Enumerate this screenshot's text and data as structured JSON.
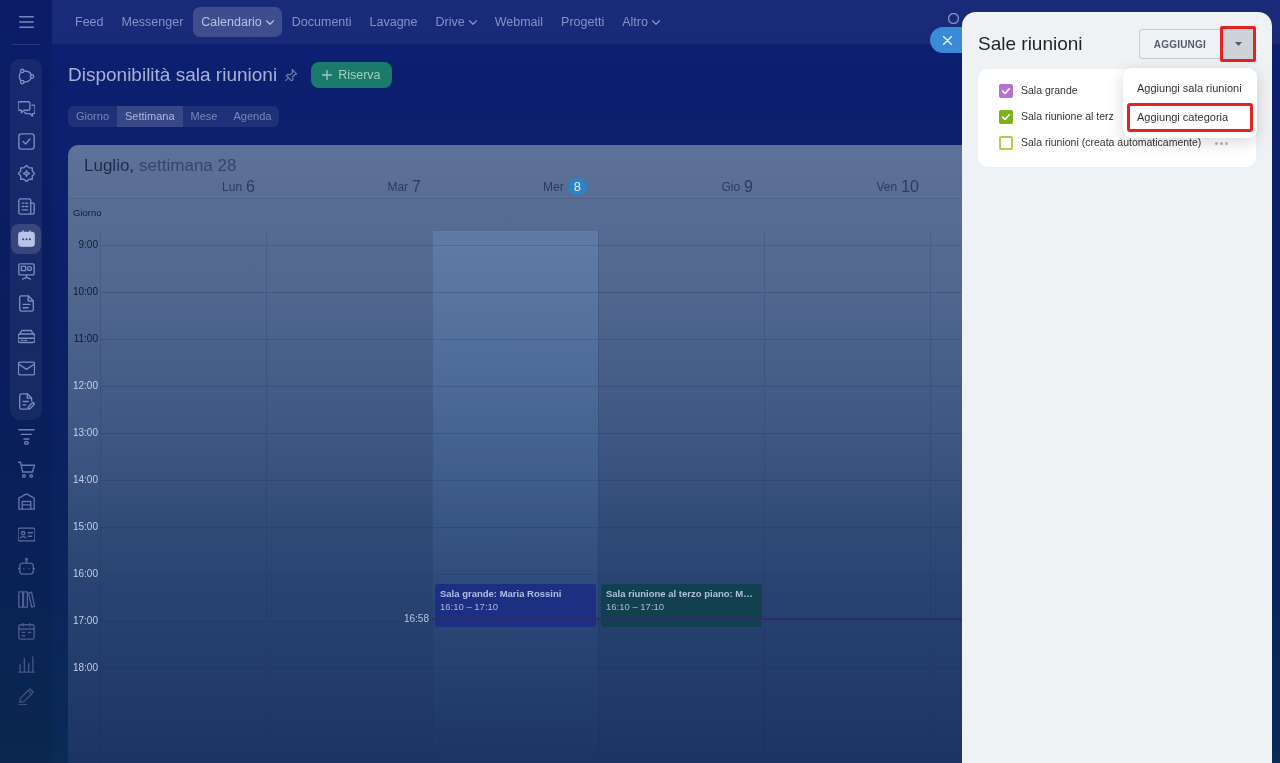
{
  "sidebar": {
    "group_items": [
      {
        "kind": "nodes",
        "selected": false
      },
      {
        "kind": "chats",
        "selected": false
      },
      {
        "kind": "tasks",
        "selected": false
      },
      {
        "kind": "badge",
        "selected": false
      },
      {
        "kind": "news",
        "selected": false
      },
      {
        "kind": "calendar",
        "selected": true
      },
      {
        "kind": "board",
        "selected": false
      },
      {
        "kind": "document",
        "selected": false
      },
      {
        "kind": "drive",
        "selected": false
      },
      {
        "kind": "mail",
        "selected": false
      },
      {
        "kind": "docedit",
        "selected": false
      }
    ],
    "items": [
      {
        "kind": "funnel",
        "selected": false
      },
      {
        "kind": "cart",
        "selected": false
      },
      {
        "kind": "garage",
        "selected": false
      },
      {
        "kind": "contact",
        "selected": false
      },
      {
        "kind": "robot",
        "selected": false
      },
      {
        "kind": "books",
        "selected": false
      },
      {
        "kind": "schedule",
        "selected": false
      },
      {
        "kind": "chart",
        "selected": false
      },
      {
        "kind": "pen",
        "selected": false
      }
    ]
  },
  "top_nav": [
    {
      "label": "Feed",
      "selected": false,
      "dropdown": false
    },
    {
      "label": "Messenger",
      "selected": false,
      "dropdown": false
    },
    {
      "label": "Calendario",
      "selected": true,
      "dropdown": true
    },
    {
      "label": "Documenti",
      "selected": false,
      "dropdown": false
    },
    {
      "label": "Lavagne",
      "selected": false,
      "dropdown": false
    },
    {
      "label": "Drive",
      "selected": false,
      "dropdown": true
    },
    {
      "label": "Webmail",
      "selected": false,
      "dropdown": false
    },
    {
      "label": "Progetti",
      "selected": false,
      "dropdown": false
    },
    {
      "label": "Altro",
      "selected": false,
      "dropdown": true
    }
  ],
  "page": {
    "title": "Disponibilità sala riunioni",
    "primary_button": "Riserva",
    "views": [
      {
        "label": "Giorno",
        "selected": false
      },
      {
        "label": "Settimana",
        "selected": true
      },
      {
        "label": "Mese",
        "selected": false
      },
      {
        "label": "Agenda",
        "selected": false
      }
    ]
  },
  "calendar": {
    "month": "Luglio,",
    "week": "settimana 28",
    "all_day_label": "Giorno",
    "days": [
      {
        "name": "Lun",
        "number": "6",
        "today": false
      },
      {
        "name": "Mar",
        "number": "7",
        "today": false
      },
      {
        "name": "Mer",
        "number": "8",
        "today": true,
        "events": [
          {
            "title": "Sala grande: Maria Rossini",
            "time": "16:10 – 17:10",
            "color": "#1d2f80"
          }
        ]
      },
      {
        "name": "Gio",
        "number": "9",
        "today": false,
        "events": [
          {
            "title": "Sala riunione al terzo piano: M…",
            "time": "16:10 – 17:10",
            "color": "#12404e"
          }
        ]
      },
      {
        "name": "Ven",
        "number": "10",
        "today": false
      }
    ],
    "hours": [
      "9:00",
      "10:00",
      "11:00",
      "12:00",
      "13:00",
      "14:00",
      "15:00",
      "16:00",
      "17:00",
      "18:00"
    ],
    "now": "16:58"
  },
  "panel": {
    "title": "Sale riunioni",
    "add_button": "AGGIUNGI",
    "toggle": {
      "highlighted": true
    },
    "menu": [
      {
        "label": "Aggiungi sala riunioni",
        "highlighted": false
      },
      {
        "label": "Aggiungi categoria",
        "highlighted": true
      }
    ],
    "rooms": [
      {
        "label": "Sala grande",
        "checked": true,
        "color": "#b870d0",
        "hovered": false
      },
      {
        "label": "Sala riunione al terz",
        "checked": true,
        "color": "#7eb21c",
        "hovered": false
      },
      {
        "label": "Sala riunioni (creata automaticamente)",
        "checked": false,
        "color": "#a9d24a",
        "hovered": true
      }
    ]
  }
}
